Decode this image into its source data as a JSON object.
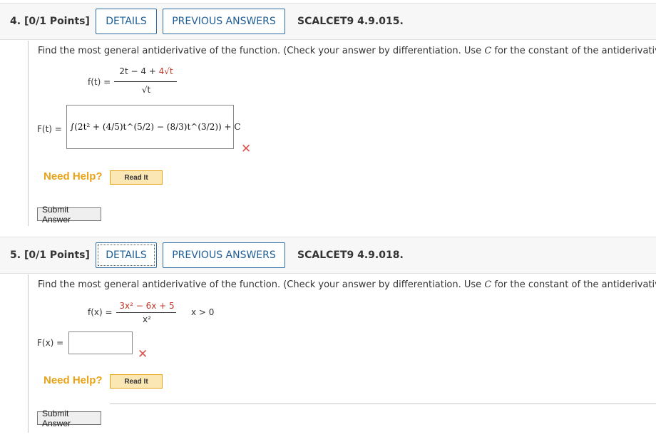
{
  "q4": {
    "number": "4.",
    "points": "[0/1 Points]",
    "details": "DETAILS",
    "previous": "PREVIOUS ANSWERS",
    "ref": "SCALCET9 4.9.015.",
    "prompt_pre": "Find the most general antiderivative of the function. (Check your answer by differentiation. Use ",
    "prompt_var": "C",
    "prompt_post": " for the constant of the antiderivative.)",
    "f_label": "f(t) =",
    "num_a": "2t − 4 + ",
    "num_b": "4√t",
    "den": "√t",
    "F_label": "F(t) =",
    "answer_expr": "∫(2t² + (4/5)t^(5/2) − (8/3)t^(3/2)) + C",
    "need_help": "Need Help?",
    "read_it": "Read It",
    "submit": "Submit Answer"
  },
  "q5": {
    "number": "5.",
    "points": "[0/1 Points]",
    "details": "DETAILS",
    "previous": "PREVIOUS ANSWERS",
    "ref": "SCALCET9 4.9.018.",
    "prompt_pre": "Find the most general antiderivative of the function. (Check your answer by differentiation. Use ",
    "prompt_var": "C",
    "prompt_post": " for the constant of the antiderivative.)",
    "f_label": "f(x) =",
    "num": "3x² − 6x + 5",
    "den": "x²",
    "cond": "x > 0",
    "F_label": "F(x) =",
    "answer_value": "",
    "need_help": "Need Help?",
    "read_it": "Read It",
    "submit": "Submit Answer"
  },
  "colors": {
    "link": "#1e5e96",
    "error": "#d9534f",
    "help": "#e8a317",
    "highlight": "#c0392b"
  },
  "icons": {
    "wrong": "x-mark-icon"
  }
}
